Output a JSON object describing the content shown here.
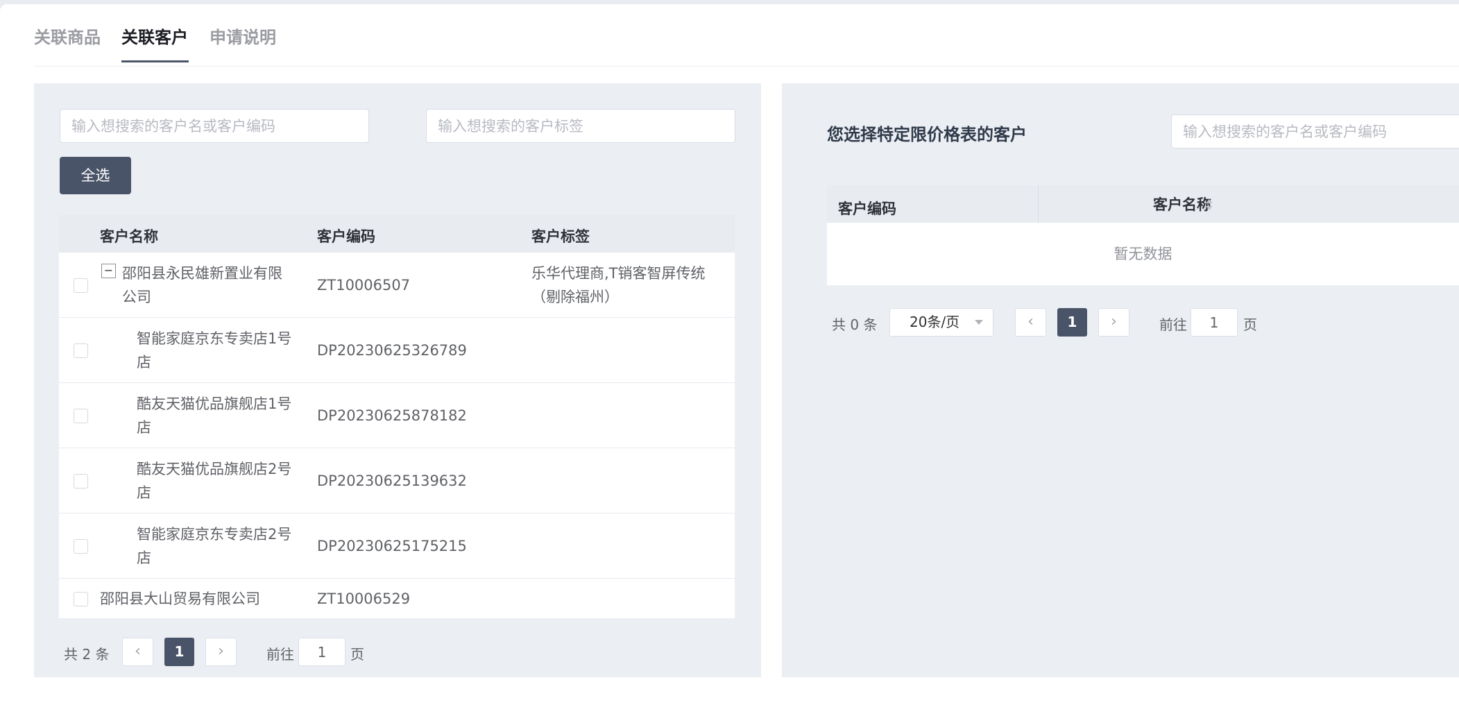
{
  "tabs": [
    {
      "label": "关联商品",
      "active": false
    },
    {
      "label": "关联客户",
      "active": true
    },
    {
      "label": "申请说明",
      "active": false
    }
  ],
  "left_panel": {
    "search_name_placeholder": "输入想搜索的客户名或客户编码",
    "search_tag_placeholder": "输入想搜索的客户标签",
    "select_all_label": "全选",
    "columns": [
      "客户名称",
      "客户编码",
      "客户标签"
    ],
    "rows": [
      {
        "name": "邵阳县永民雄新置业有限公司",
        "code": "ZT10006507",
        "tag": "乐华代理商,T销客智屏传统（剔除福州）",
        "expandable": true,
        "expand_symbol": "−",
        "level": 0
      },
      {
        "name": "智能家庭京东专卖店1号店",
        "code": "DP20230625326789",
        "tag": "",
        "level": 1
      },
      {
        "name": "酷友天猫优品旗舰店1号店",
        "code": "DP20230625878182",
        "tag": "",
        "level": 1
      },
      {
        "name": "酷友天猫优品旗舰店2号店",
        "code": "DP20230625139632",
        "tag": "",
        "level": 1
      },
      {
        "name": "智能家庭京东专卖店2号店",
        "code": "DP20230625175215",
        "tag": "",
        "level": 1
      },
      {
        "name": "邵阳县大山贸易有限公司",
        "code": "ZT10006529",
        "tag": "",
        "level": 0
      }
    ],
    "pagination": {
      "total_text": "共 2 条",
      "current_page": "1",
      "goto_label": "前往",
      "goto_value": "1",
      "page_suffix": "页",
      "prev_icon": "‹",
      "next_icon": "›"
    }
  },
  "right_panel": {
    "title": "您选择特定限价格表的客户",
    "search_placeholder": "输入想搜索的客户名或客户编码",
    "columns": [
      "客户编码",
      "客户名称"
    ],
    "empty_text": "暂无数据",
    "pagination": {
      "total_text": "共 0 条",
      "page_size": "20条/页",
      "current_page": "1",
      "goto_label": "前往",
      "goto_value": "1",
      "page_suffix": "页",
      "prev_icon": "‹",
      "next_icon": "›"
    }
  },
  "colors": {
    "accent": "#4a5468",
    "panel_bg": "#ebeef3",
    "active_tab": "#1b1d22"
  }
}
